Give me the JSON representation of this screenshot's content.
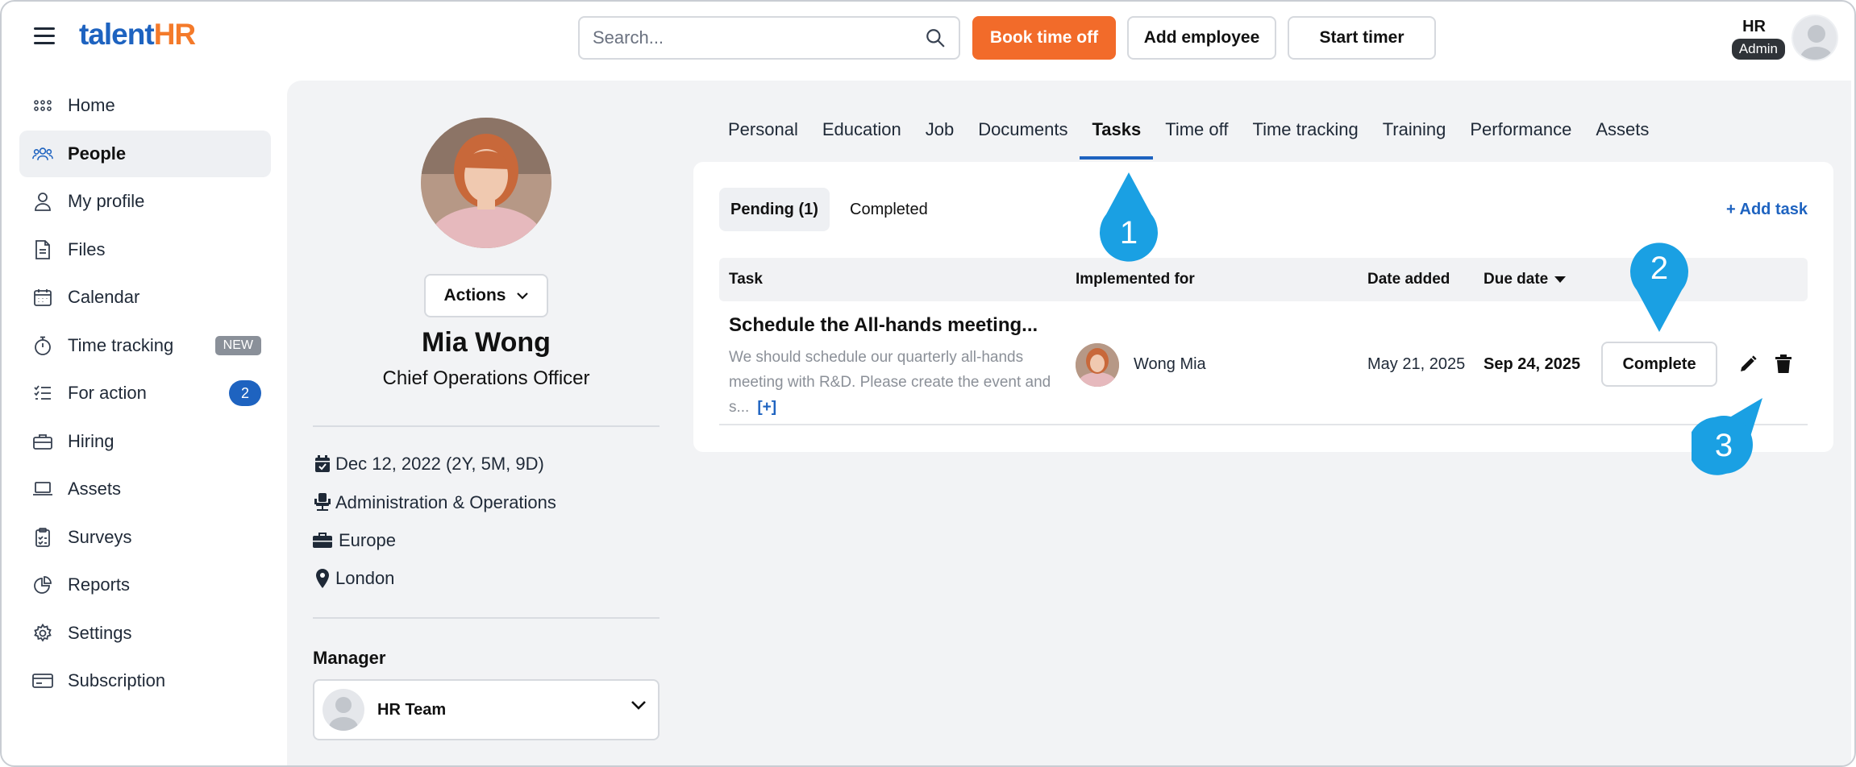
{
  "app": {
    "logo_part1": "talent",
    "logo_part2": "HR"
  },
  "header": {
    "search_placeholder": "Search...",
    "book_time_off": "Book time off",
    "add_employee": "Add employee",
    "start_timer": "Start timer",
    "user_initials": "HR",
    "user_role": "Admin"
  },
  "sidebar": {
    "items": [
      {
        "label": "Home"
      },
      {
        "label": "People"
      },
      {
        "label": "My profile"
      },
      {
        "label": "Files"
      },
      {
        "label": "Calendar"
      },
      {
        "label": "Time tracking",
        "badge": "NEW"
      },
      {
        "label": "For action",
        "count": "2"
      },
      {
        "label": "Hiring"
      },
      {
        "label": "Assets"
      },
      {
        "label": "Surveys"
      },
      {
        "label": "Reports"
      },
      {
        "label": "Settings"
      },
      {
        "label": "Subscription"
      }
    ]
  },
  "profile": {
    "actions_label": "Actions",
    "name": "Mia Wong",
    "title": "Chief Operations Officer",
    "hire_date": "Dec 12, 2022 (2Y, 5M, 9D)",
    "department": "Administration & Operations",
    "region": "Europe",
    "location": "London",
    "manager_label": "Manager",
    "manager_name": "HR Team"
  },
  "tabs": [
    "Personal",
    "Education",
    "Job",
    "Documents",
    "Tasks",
    "Time off",
    "Time tracking",
    "Training",
    "Performance",
    "Assets"
  ],
  "tasks": {
    "pending_label": "Pending (1)",
    "completed_label": "Completed",
    "add_task": "+ Add task",
    "columns": {
      "task": "Task",
      "implemented_for": "Implemented for",
      "date_added": "Date added",
      "due_date": "Due date"
    },
    "rows": [
      {
        "title": "Schedule the All-hands meeting...",
        "description": "We should schedule our quarterly all-hands meeting with R&D. Please create the event and s...",
        "more": "[+]",
        "implemented_for": "Wong Mia",
        "date_added": "May 21, 2025",
        "due_date": "Sep 24, 2025",
        "complete_label": "Complete"
      }
    ]
  },
  "annotations": {
    "marker1": "1",
    "marker2": "2",
    "marker3": "3"
  },
  "colors": {
    "brand_blue": "#1e63c0",
    "brand_orange": "#f26b2a",
    "marker_blue": "#1aa0e3"
  }
}
